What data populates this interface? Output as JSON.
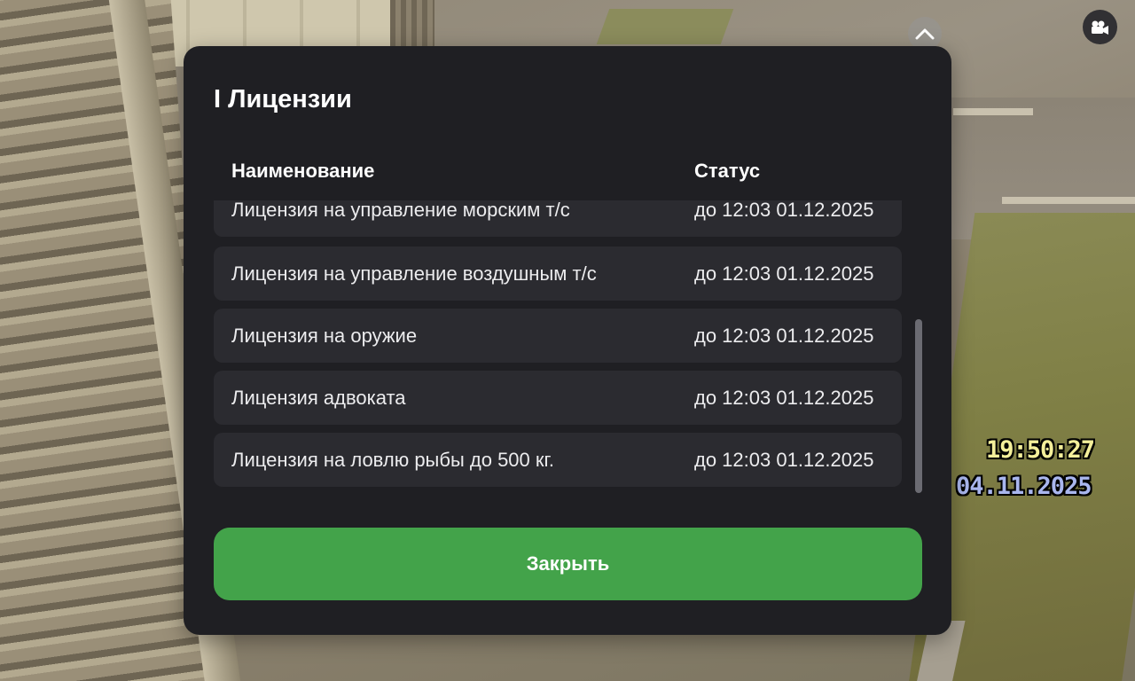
{
  "hud": {
    "time": "19:50:27",
    "date": "04.11.2025",
    "collapse_icon": "chevron-up-icon",
    "camera_icon": "video-camera-icon"
  },
  "modal": {
    "title": "I Лицензии",
    "columns": {
      "name": "Наименование",
      "status": "Статус"
    },
    "rows": [
      {
        "name": "Лицензия на управление морским т/с",
        "status": "до 12:03 01.12.2025"
      },
      {
        "name": "Лицензия на управление воздушным т/с",
        "status": "до 12:03 01.12.2025"
      },
      {
        "name": "Лицензия на оружие",
        "status": "до 12:03 01.12.2025"
      },
      {
        "name": "Лицензия адвоката",
        "status": "до 12:03 01.12.2025"
      },
      {
        "name": "Лицензия на ловлю рыбы до 500 кг.",
        "status": "до 12:03 01.12.2025"
      }
    ],
    "scroll_position": 1.0,
    "close_label": "Закрыть"
  },
  "colors": {
    "modal_bg": "#1f1f23",
    "row_bg": "#2b2b30",
    "accent_green": "#43a34a",
    "clock_time": "#f4ef9a",
    "clock_date": "#a9b6ee"
  }
}
